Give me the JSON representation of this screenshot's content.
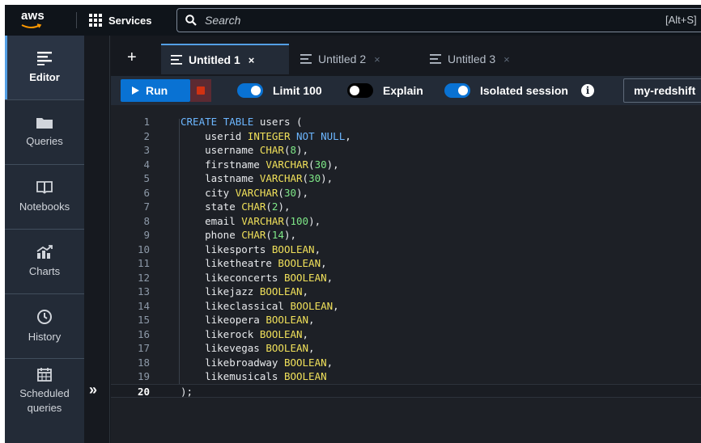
{
  "header": {
    "logo_text": "aws",
    "services_label": "Services",
    "search_placeholder": "Search",
    "search_shortcut": "[Alt+S]"
  },
  "nav": {
    "items": [
      {
        "label": "Editor",
        "icon": "editor-icon",
        "active": true
      },
      {
        "label": "Queries",
        "icon": "folder-icon"
      },
      {
        "label": "Notebooks",
        "icon": "book-icon"
      },
      {
        "label": "Charts",
        "icon": "chart-icon"
      },
      {
        "label": "History",
        "icon": "clock-icon"
      },
      {
        "label": "Scheduled\nqueries",
        "icon": "calendar-icon"
      }
    ],
    "expand_glyph": "»"
  },
  "tabs": {
    "add_glyph": "+",
    "close_glyph": "×",
    "items": [
      {
        "label": "Untitled 1",
        "active": true
      },
      {
        "label": "Untitled 2",
        "active": false
      },
      {
        "label": "Untitled 3",
        "active": false
      }
    ]
  },
  "toolbar": {
    "run_label": "Run",
    "limit_label": "Limit 100",
    "limit_on": true,
    "explain_label": "Explain",
    "explain_on": false,
    "isolated_label": "Isolated session",
    "isolated_on": true,
    "info_glyph": "i",
    "connection": "my-redshift"
  },
  "editor": {
    "current_line": 20,
    "lines": [
      "CREATE TABLE users (",
      "    userid INTEGER NOT NULL,",
      "    username CHAR(8),",
      "    firstname VARCHAR(30),",
      "    lastname VARCHAR(30),",
      "    city VARCHAR(30),",
      "    state CHAR(2),",
      "    email VARCHAR(100),",
      "    phone CHAR(14),",
      "    likesports BOOLEAN,",
      "    liketheatre BOOLEAN,",
      "    likeconcerts BOOLEAN,",
      "    likejazz BOOLEAN,",
      "    likeclassical BOOLEAN,",
      "    likeopera BOOLEAN,",
      "    likerock BOOLEAN,",
      "    likevegas BOOLEAN,",
      "    likebroadway BOOLEAN,",
      "    likemusicals BOOLEAN",
      ");"
    ]
  },
  "colors": {
    "accent": "#0972d3",
    "keyword": "#6cb6ff",
    "type": "#f0e05a",
    "number": "#7ee787",
    "stop": "#d13212"
  }
}
